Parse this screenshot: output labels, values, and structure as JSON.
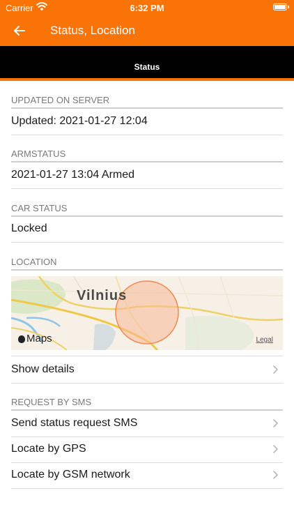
{
  "status_bar": {
    "carrier": "Carrier",
    "time": "6:32 PM"
  },
  "nav": {
    "title": "Status, Location"
  },
  "tabs": [
    {
      "label": "Status"
    }
  ],
  "sections": {
    "updated": {
      "header": "UPDATED ON SERVER",
      "value": "Updated: 2021-01-27 12:04"
    },
    "armstatus": {
      "header": "ARMSTATUS",
      "value": "2021-01-27 13:04 Armed"
    },
    "car_status": {
      "header": "CAR STATUS",
      "value": "Locked"
    },
    "location": {
      "header": "LOCATION",
      "map": {
        "city_label": "Vilnius",
        "brand": "Maps",
        "legal": "Legal"
      },
      "show_details": "Show details"
    },
    "sms": {
      "header": "REQUEST BY SMS",
      "items": [
        "Send status request SMS",
        "Locate by GPS",
        "Locate by GSM network"
      ]
    }
  },
  "colors": {
    "accent": "#f97306",
    "tab_bar": "#000000",
    "header_text": "#7a7a7a"
  },
  "icons": {
    "back": "arrow-left-icon",
    "chevron": "chevron-right-icon",
    "wifi": "wifi-icon",
    "battery": "battery-icon"
  }
}
